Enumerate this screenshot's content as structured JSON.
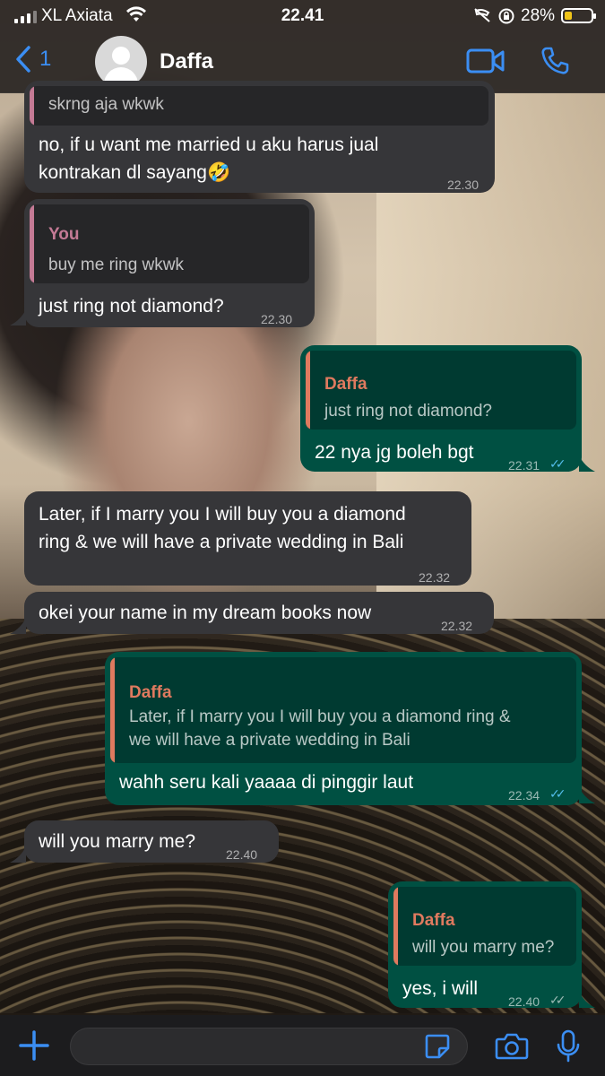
{
  "status_bar": {
    "carrier": "XL Axiata",
    "time": "22.41",
    "battery_percent": "28%",
    "battery_level": 0.28
  },
  "header": {
    "back_count": "1",
    "contact_name": "Daffa",
    "icons": [
      "chevron-left-icon",
      "avatar-icon",
      "video-icon",
      "phone-icon"
    ]
  },
  "colors": {
    "incoming_bubble": "#363639",
    "outgoing_bubble": "#005042",
    "accent_blue": "#3b8ef3",
    "read_tick": "#53bdeb",
    "quote_you": "#c47a95",
    "quote_daffa": "#e07a5f"
  },
  "messages": [
    {
      "id": "m1",
      "dir": "in",
      "quote": {
        "text": "skrng aja wkwk"
      },
      "text_lines": [
        "no, if u want me married u aku harus jual",
        "kontrakan dl sayang🤣"
      ],
      "time": "22.30"
    },
    {
      "id": "m2",
      "dir": "in",
      "quote": {
        "name": "You",
        "text": "buy me ring wkwk"
      },
      "text_lines": [
        "just ring not diamond?"
      ],
      "time": "22.30"
    },
    {
      "id": "m3",
      "dir": "out",
      "quote": {
        "name": "Daffa",
        "text": "just ring not diamond?"
      },
      "text_lines": [
        "22 nya jg boleh bgt"
      ],
      "time": "22.31",
      "status": "read"
    },
    {
      "id": "m4",
      "dir": "in",
      "text_lines": [
        "Later, if I marry you I will buy you a diamond",
        "ring & we will have a private wedding in Bali"
      ],
      "time": "22.32"
    },
    {
      "id": "m5",
      "dir": "in",
      "text_lines": [
        "okei your name in my dream books now"
      ],
      "time": "22.32"
    },
    {
      "id": "m6",
      "dir": "out",
      "quote": {
        "name": "Daffa",
        "text_lines": [
          "Later, if I marry you I will buy you a diamond ring &",
          "we will have a private wedding in Bali"
        ]
      },
      "text_lines": [
        "wahh seru kali yaaaa di pinggir laut"
      ],
      "time": "22.34",
      "status": "read"
    },
    {
      "id": "m7",
      "dir": "in",
      "text_lines": [
        "will you marry me?"
      ],
      "time": "22.40"
    },
    {
      "id": "m8",
      "dir": "out",
      "quote": {
        "name": "Daffa",
        "text": "will you marry me?"
      },
      "text_lines": [
        "yes, i will"
      ],
      "time": "22.40",
      "status": "delivered"
    }
  ],
  "input_bar": {
    "message_value": "",
    "icons": [
      "plus-icon",
      "sticker-icon",
      "camera-icon",
      "mic-icon"
    ]
  }
}
